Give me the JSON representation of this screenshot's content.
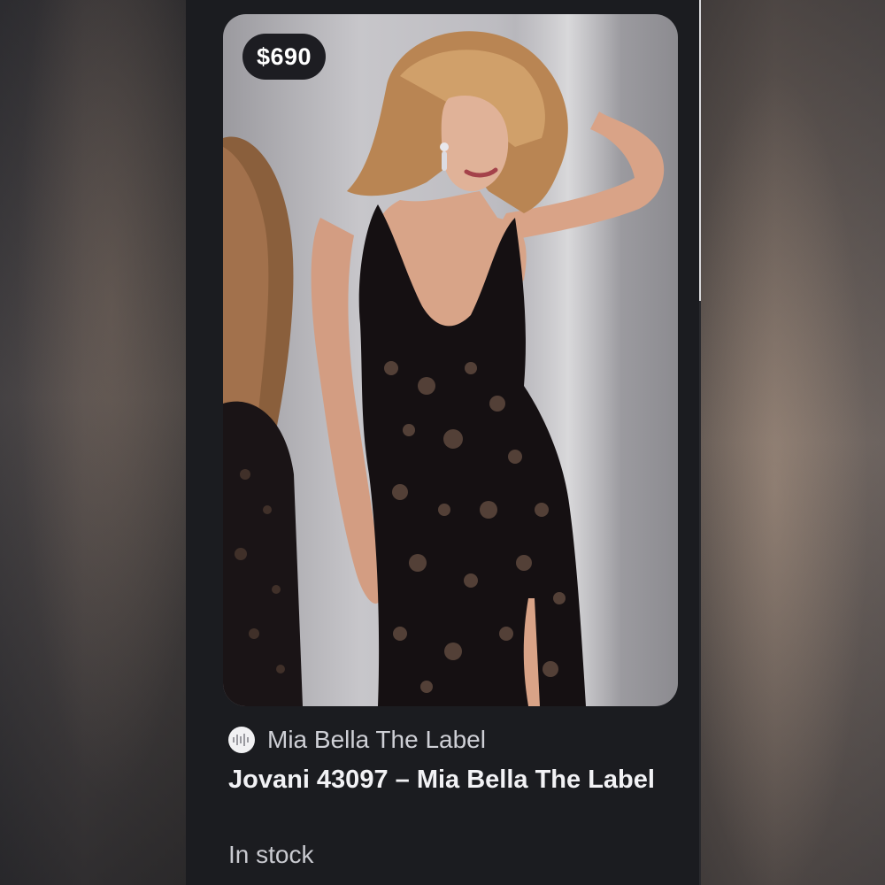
{
  "product": {
    "price": "$690",
    "store_name": "Mia Bella The Label",
    "title": "Jovani 43097 – Mia Bella The Label",
    "stock_status": "In stock",
    "image_icon": "product-photo",
    "store_icon": "store-logo-icon"
  },
  "colors": {
    "panel_background": "#1b1c20",
    "price_badge_background": "#1d1d22",
    "title_text": "#f2f2f5",
    "secondary_text": "#c9cad0"
  }
}
